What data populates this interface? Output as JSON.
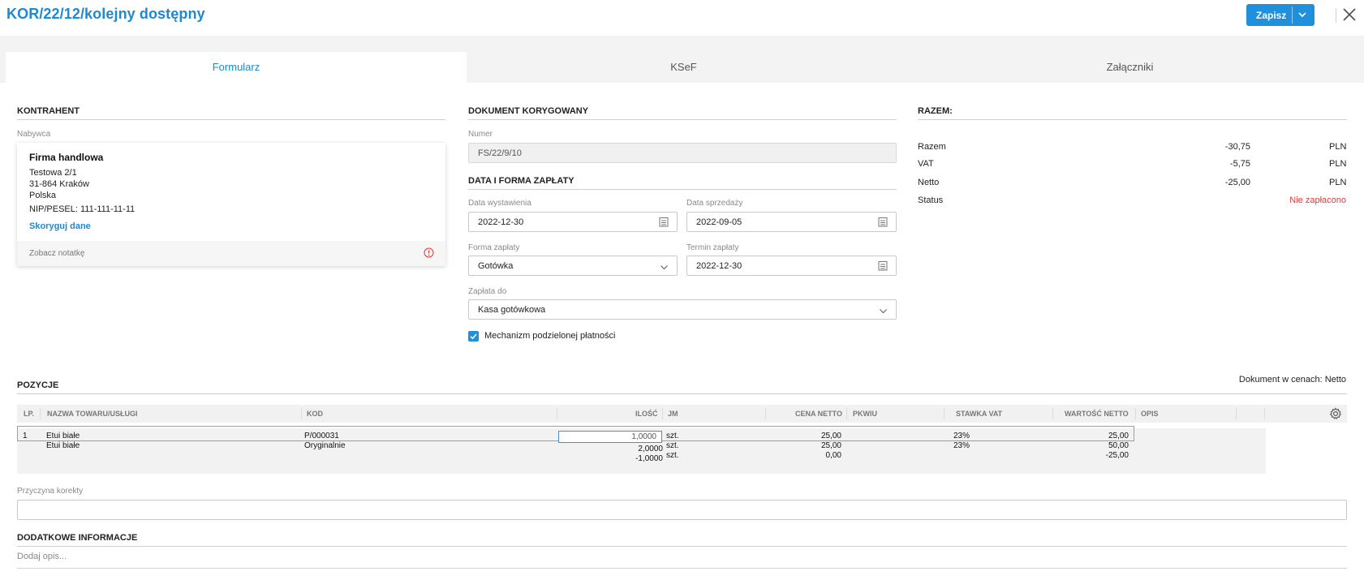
{
  "header": {
    "title": "KOR/22/12/kolejny dostępny",
    "save_label": "Zapisz"
  },
  "tabs": [
    {
      "label": "Formularz",
      "active": true
    },
    {
      "label": "KSeF",
      "active": false
    },
    {
      "label": "Załączniki",
      "active": false
    }
  ],
  "kontrahent": {
    "heading": "KONTRAHENT",
    "buyer_label": "Nabywca",
    "name": "Firma handlowa",
    "street": "Testowa 2/1",
    "city": "31-864 Kraków",
    "country": "Polska",
    "nip": "NIP/PESEL: 111-111-11-11",
    "edit_link": "Skoryguj dane",
    "note_link": "Zobacz notatkę"
  },
  "dokument": {
    "heading": "DOKUMENT KORYGOWANY",
    "numer_label": "Numer",
    "numer_value": "FS/22/9/10"
  },
  "platnosc": {
    "heading": "DATA I FORMA ZAPŁATY",
    "data_wystawienia_label": "Data wystawienia",
    "data_wystawienia": "2022-12-30",
    "data_sprzedazy_label": "Data sprzedaży",
    "data_sprzedazy": "2022-09-05",
    "forma_label": "Forma zapłaty",
    "forma": "Gotówka",
    "termin_label": "Termin zapłaty",
    "termin": "2022-12-30",
    "zaplata_do_label": "Zapłata do",
    "zaplata_do": "Kasa gotówkowa",
    "split_payment_label": "Mechanizm podzielonej płatności",
    "split_payment_checked": true
  },
  "razem": {
    "heading": "RAZEM:",
    "rows": [
      {
        "label": "Razem",
        "value": "-30,75",
        "currency": "PLN"
      },
      {
        "label": "VAT",
        "value": "-5,75",
        "currency": "PLN"
      },
      {
        "label": "Netto",
        "value": "-25,00",
        "currency": "PLN"
      }
    ],
    "status_label": "Status",
    "status_value": "Nie zapłacono",
    "status_color": "#e53935"
  },
  "pozycje": {
    "heading": "POZYCJE",
    "prices_note": "Dokument w cenach: Netto",
    "columns": [
      "LP.",
      "NAZWA TOWARU/USŁUGI",
      "KOD",
      "ILOŚĆ",
      "JM",
      "CENA NETTO",
      "PKWIU",
      "STAWKA VAT",
      "WARTOŚĆ NETTO",
      "OPIS"
    ],
    "row": {
      "lp": "1",
      "name_before": "Etui białe",
      "name_after": "Etui białe",
      "kod": "P/000031",
      "kod2": "Oryginalnie",
      "qty_input": "1,0000",
      "qty_orig": "2,0000",
      "qty_diff": "-1,0000",
      "jm1": "szt.",
      "jm2": "szt.",
      "jm3": "szt.",
      "cena1": "25,00",
      "cena2": "25,00",
      "cena3": "0,00",
      "vat1": "23%",
      "vat2": "23%",
      "wart1": "25,00",
      "wart2": "50,00",
      "wart3": "-25,00"
    }
  },
  "przyczyna": {
    "label": "Przyczyna korekty",
    "value": ""
  },
  "dodatkowe": {
    "heading": "DODATKOWE INFORMACJE",
    "placeholder": "Dodaj opis..."
  },
  "colors": {
    "accent": "#1e88d0",
    "button": "#1e90dc",
    "highlight_border": "#e98a3a"
  }
}
